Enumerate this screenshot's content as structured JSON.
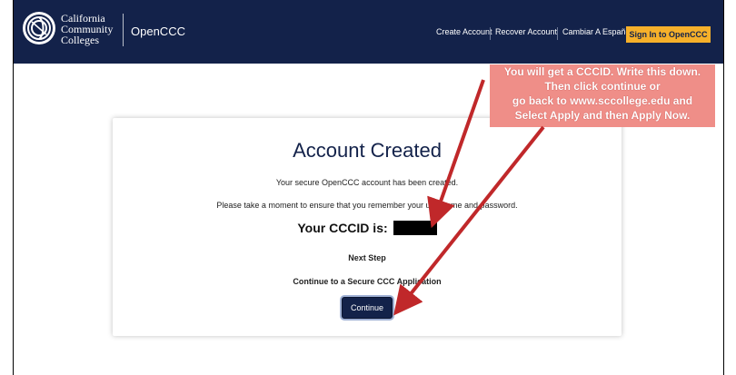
{
  "header": {
    "logo_lines": [
      "California",
      "Community",
      "Colleges"
    ],
    "app_name": "OpenCCC",
    "nav": {
      "create_account": "Create Account",
      "recover_account": "Recover Account",
      "spanish": "Cambiar A Español",
      "sign_in": "Sign In to OpenCCC"
    },
    "colors": {
      "bar": "#13224a",
      "sign_in_bg": "#f6b02a"
    }
  },
  "callout": {
    "lines": [
      "You will get a CCCID. Write this down.",
      "Then click continue or",
      "go back to www.sccollege.edu and",
      "Select Apply and then Apply Now."
    ],
    "color": "#ef8e88",
    "arrow_color": "#c0282a"
  },
  "card": {
    "title": "Account Created",
    "created_message": "Your secure OpenCCC account has been created.",
    "remember_message": "Please take a moment to ensure that you remember your username and password.",
    "cccid_label": "Your CCCID is:",
    "next_step": "Next Step",
    "continue_text": "Continue to a Secure CCC Application",
    "continue_button": "Continue"
  }
}
